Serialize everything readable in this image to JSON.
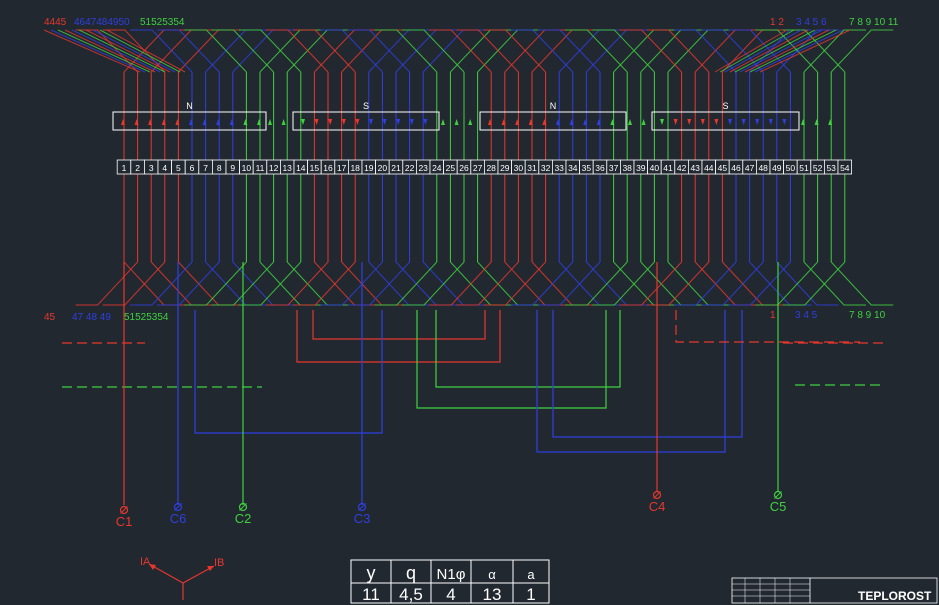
{
  "colors": {
    "background": "#212830",
    "phase_a": "#e8372d",
    "phase_b": "#2f3fe0",
    "phase_c": "#3fd13f",
    "outline": "#ffffff"
  },
  "top_labels": {
    "left_red": "4445",
    "left_blue": "4647484950",
    "left_green": "51525354",
    "right_red": "1 2",
    "right_blue": "3 4 5 6",
    "right_green": "7 8 9 10 11"
  },
  "bottom_labels": {
    "left_red": "45",
    "left_blue": "47 48 49",
    "left_green": "51525354",
    "right_red": "1",
    "right_blue": "3 4 5",
    "right_green": "7 8 9 10"
  },
  "poles": [
    "N",
    "S",
    "N",
    "S"
  ],
  "slot_count": 54,
  "terminals": [
    {
      "label": "C1",
      "color": "#e8372d"
    },
    {
      "label": "C6",
      "color": "#2f3fe0"
    },
    {
      "label": "C2",
      "color": "#3fd13f"
    },
    {
      "label": "C3",
      "color": "#2f3fe0"
    },
    {
      "label": "C4",
      "color": "#e8372d"
    },
    {
      "label": "C5",
      "color": "#3fd13f"
    }
  ],
  "phasor": {
    "a_label": "IA",
    "b_label": "IB"
  },
  "params_table": {
    "headers": [
      "y",
      "q",
      "N1φ",
      "α",
      "a"
    ],
    "values": [
      "11",
      "4,5",
      "4",
      "13",
      "1"
    ]
  },
  "stamp": {
    "brand": "TEPLOROST"
  }
}
